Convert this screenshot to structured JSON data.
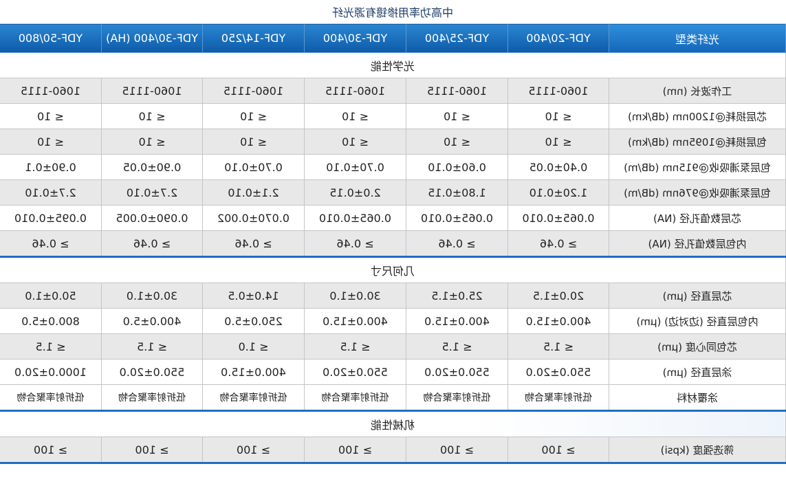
{
  "title": "中高功率用掺镱有源光纤",
  "header": [
    "光纤类型",
    "YDF-20/400",
    "YDF-25/400",
    "YDF-30/400",
    "YDF-14/250",
    "YDF-30/400 (HA)",
    "YDF-50/800"
  ],
  "sections": [
    {
      "name": "光学性能",
      "rows": [
        {
          "label": "工作波长 (nm)",
          "values": [
            "1060-1115",
            "1060-1115",
            "1060-1115",
            "1060-1115",
            "1060-1115",
            "1060-1115"
          ]
        },
        {
          "label": "芯层损耗@1200nm (dB/km)",
          "values": [
            "≤ 10",
            "≤ 10",
            "≤ 10",
            "≤ 10",
            "≤ 10",
            "≤ 10"
          ]
        },
        {
          "label": "包层损耗@1095nm (dB/km)",
          "values": [
            "≤ 10",
            "≤ 10",
            "≤ 10",
            "≤ 10",
            "≤ 10",
            "≤ 10"
          ]
        },
        {
          "label": "包层泵浦吸收@915nm (dB/m)",
          "values": [
            "0.40±0.05",
            "0.60±0.10",
            "0.70±0.10",
            "0.70±0.10",
            "0.90±0.05",
            "0.90±0.1"
          ]
        },
        {
          "label": "包层泵浦吸收@976nm (dB/m)",
          "values": [
            "1.20±0.10",
            "1.80±0.15",
            "2.0±0.15",
            "2.1±0.10",
            "2.7±0.10",
            "2.7±0.10"
          ]
        },
        {
          "label": "芯层数值孔径 (NA)",
          "values": [
            "0.065±0.010",
            "0.065±0.010",
            "0.065±0.010",
            "0.070±0.002",
            "0.090±0.005",
            "0.095±0.010"
          ]
        },
        {
          "label": "内包层数值孔径 (NA)",
          "values": [
            "≥ 0.46",
            "≥ 0.46",
            "≥ 0.46",
            "≥ 0.46",
            "≥ 0.46",
            "≥ 0.46"
          ]
        }
      ]
    },
    {
      "name": "几何尺寸",
      "rows": [
        {
          "label": "芯层直径 (μm)",
          "values": [
            "20.0±1.5",
            "25.0±1.5",
            "30.0±1.0",
            "14.0±0.5",
            "30.0±1.0",
            "50.0±1.0"
          ]
        },
        {
          "label": "内包层直径 (边对边) (μm)",
          "values": [
            "400.0±15.0",
            "400.0±15.0",
            "400.0±15.0",
            "250.0±5.0",
            "400.0±5.0",
            "800.0±5.0"
          ]
        },
        {
          "label": "芯包同心度 (μm)",
          "values": [
            "≤ 1.5",
            "≤ 1.5",
            "≤ 1.5",
            "≤ 1.0",
            "≤ 1.5",
            "≤ 1.5"
          ]
        },
        {
          "label": "涂层直径 (μm)",
          "values": [
            "550.0±20.0",
            "550.0±20.0",
            "550.0±20.0",
            "400.0±15.0",
            "550.0±20.0",
            "1000.0±20.0"
          ]
        },
        {
          "label": "涂覆材料",
          "values": [
            "低折射率聚合物",
            "低折射率聚合物",
            "低折射率聚合物",
            "低折射率聚合物",
            "低折射率聚合物",
            "低折射率聚合物"
          ]
        }
      ]
    },
    {
      "name": "机械性能",
      "rows": [
        {
          "label": "筛选强度 (kpsi)",
          "values": [
            "≥ 100",
            "≥ 100",
            "≥ 100",
            "≥ 100",
            "≥ 100",
            "≥ 100"
          ]
        }
      ]
    }
  ]
}
